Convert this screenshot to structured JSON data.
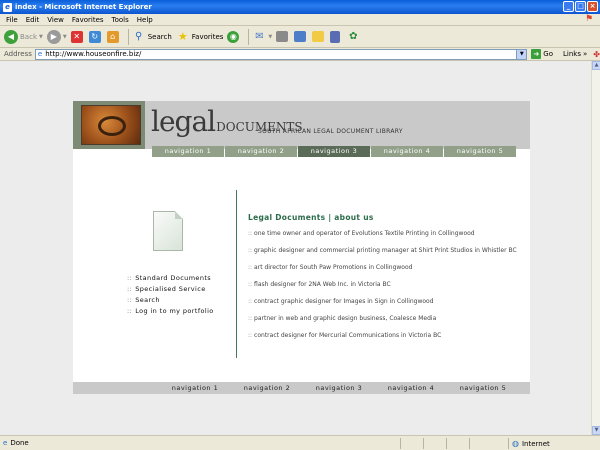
{
  "window": {
    "title": "index - Microsoft Internet Explorer",
    "buttons": [
      "_",
      "□",
      "×"
    ]
  },
  "menu": [
    "File",
    "Edit",
    "View",
    "Favorites",
    "Tools",
    "Help"
  ],
  "toolbar": {
    "back": "Back",
    "search": "Search",
    "favorites": "Favorites"
  },
  "address": {
    "label": "Address",
    "url": "http://www.houseonfire.biz/",
    "go": "Go",
    "links": "Links"
  },
  "site": {
    "title_main": "legal",
    "title_suffix": "DOCUMENTS",
    "subtitle": "SOUTH AFRICAN LEGAL DOCUMENT LIBRARY",
    "top_nav": [
      "navigation 1",
      "navigation 2",
      "navigation 3",
      "navigation 4",
      "navigation 5"
    ],
    "active_nav_index": 2,
    "side_links": [
      "Standard Documents",
      "Specialised Service",
      "Search",
      "Log in to my portfolio"
    ],
    "section_title": "Legal Documents | about us",
    "about_items": [
      "one time owner and operator of Evolutions Textile Printing in Collingwood",
      "graphic designer and commercial printing manager at Shirt Print Studios in Whistler BC",
      "art director for South Paw Promotions in Collingwood",
      "flash designer for 2NA Web Inc. in Victoria BC",
      "contract graphic designer for Images in Sign in Collingwood",
      "partner in web and graphic design business, Coalesce Media",
      "contract designer for Mercurial Communications in Victoria BC"
    ],
    "bullet": "::",
    "footer_nav": [
      "navigation 1",
      "navigation 2",
      "navigation 3",
      "navigation 4",
      "navigation 5"
    ]
  },
  "status": {
    "text": "Done",
    "zone": "Internet"
  }
}
